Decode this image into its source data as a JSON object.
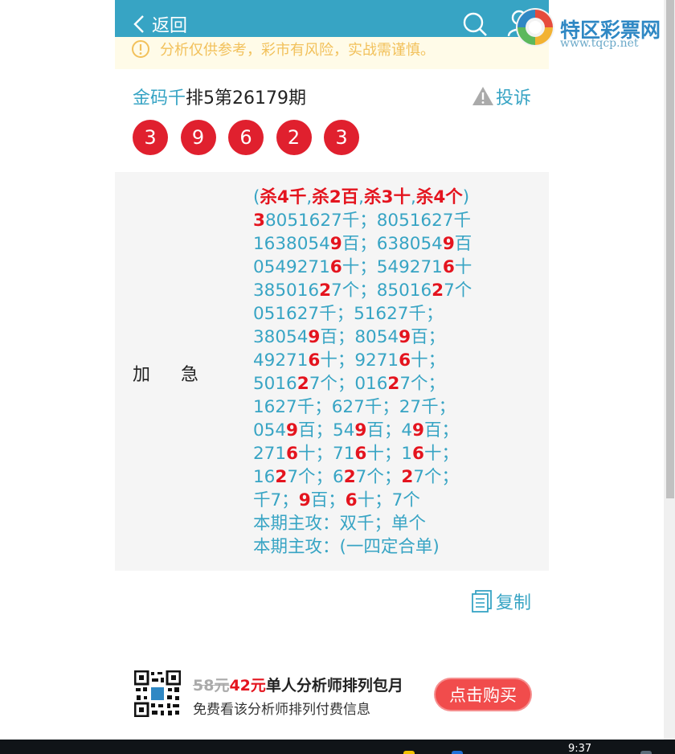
{
  "header": {
    "back_label": "返回"
  },
  "notice": {
    "text": "分析仅供参考，彩市有风险，实战需谨慎。"
  },
  "issue": {
    "title_link": "金码千",
    "title_text": "排5第26179期",
    "complain_label": "投诉"
  },
  "balls": [
    "3",
    "9",
    "6",
    "2",
    "3"
  ],
  "prediction": {
    "label": "加急",
    "lines": [
      [
        {
          "t": "("
        },
        {
          "t": "杀4千",
          "r": true
        },
        {
          "t": ","
        },
        {
          "t": "杀2百",
          "r": true
        },
        {
          "t": ","
        },
        {
          "t": "杀3十",
          "r": true
        },
        {
          "t": ","
        },
        {
          "t": "杀4个",
          "r": true
        },
        {
          "t": ")"
        }
      ],
      [
        {
          "t": "3",
          "r": true
        },
        {
          "t": "8051627千；8051627千"
        }
      ],
      [
        {
          "t": "1638054"
        },
        {
          "t": "9",
          "r": true
        },
        {
          "t": "百；638054"
        },
        {
          "t": "9",
          "r": true
        },
        {
          "t": "百"
        }
      ],
      [
        {
          "t": "0549271"
        },
        {
          "t": "6",
          "r": true
        },
        {
          "t": "十；549271"
        },
        {
          "t": "6",
          "r": true
        },
        {
          "t": "十"
        }
      ],
      [
        {
          "t": "385016"
        },
        {
          "t": "2",
          "r": true
        },
        {
          "t": "7个；85016"
        },
        {
          "t": "2",
          "r": true
        },
        {
          "t": "7个"
        }
      ],
      [
        {
          "t": "051627千；51627千；"
        }
      ],
      [
        {
          "t": "38054"
        },
        {
          "t": "9",
          "r": true
        },
        {
          "t": "百；8054"
        },
        {
          "t": "9",
          "r": true
        },
        {
          "t": "百；"
        }
      ],
      [
        {
          "t": "49271"
        },
        {
          "t": "6",
          "r": true
        },
        {
          "t": "十；9271"
        },
        {
          "t": "6",
          "r": true
        },
        {
          "t": "十；"
        }
      ],
      [
        {
          "t": "5016"
        },
        {
          "t": "2",
          "r": true
        },
        {
          "t": "7个；016"
        },
        {
          "t": "2",
          "r": true
        },
        {
          "t": "7个；"
        }
      ],
      [
        {
          "t": "1627千；627千；27千；"
        }
      ],
      [
        {
          "t": "054"
        },
        {
          "t": "9",
          "r": true
        },
        {
          "t": "百；54"
        },
        {
          "t": "9",
          "r": true
        },
        {
          "t": "百；4"
        },
        {
          "t": "9",
          "r": true
        },
        {
          "t": "百；"
        }
      ],
      [
        {
          "t": "271"
        },
        {
          "t": "6",
          "r": true
        },
        {
          "t": "十；71"
        },
        {
          "t": "6",
          "r": true
        },
        {
          "t": "十；1"
        },
        {
          "t": "6",
          "r": true
        },
        {
          "t": "十；"
        }
      ],
      [
        {
          "t": "16"
        },
        {
          "t": "2",
          "r": true
        },
        {
          "t": "7个；6"
        },
        {
          "t": "2",
          "r": true
        },
        {
          "t": "7个；"
        },
        {
          "t": "2",
          "r": true
        },
        {
          "t": "7个；"
        }
      ],
      [
        {
          "t": "千7；"
        },
        {
          "t": "9",
          "r": true
        },
        {
          "t": "百；"
        },
        {
          "t": "6",
          "r": true
        },
        {
          "t": "十；7个"
        }
      ],
      [
        {
          "t": "本期主攻：双千；单个"
        }
      ],
      [
        {
          "t": "本期主攻：(一四定合单)"
        }
      ]
    ]
  },
  "copy_label": "复制",
  "promo": {
    "old_price": "58元",
    "new_price": "42元",
    "title": "单人分析师排列包月",
    "subtitle": "免费看该分析师排列付费信息",
    "buy_label": "点击购买"
  },
  "watermark": {
    "name": "特区彩票网",
    "url": "www.tqcp.net"
  },
  "taskbar": {
    "time": "9:37"
  },
  "colors": {
    "teal": "#37a4c4",
    "red": "#e0202e",
    "notice": "#f2c15b"
  }
}
